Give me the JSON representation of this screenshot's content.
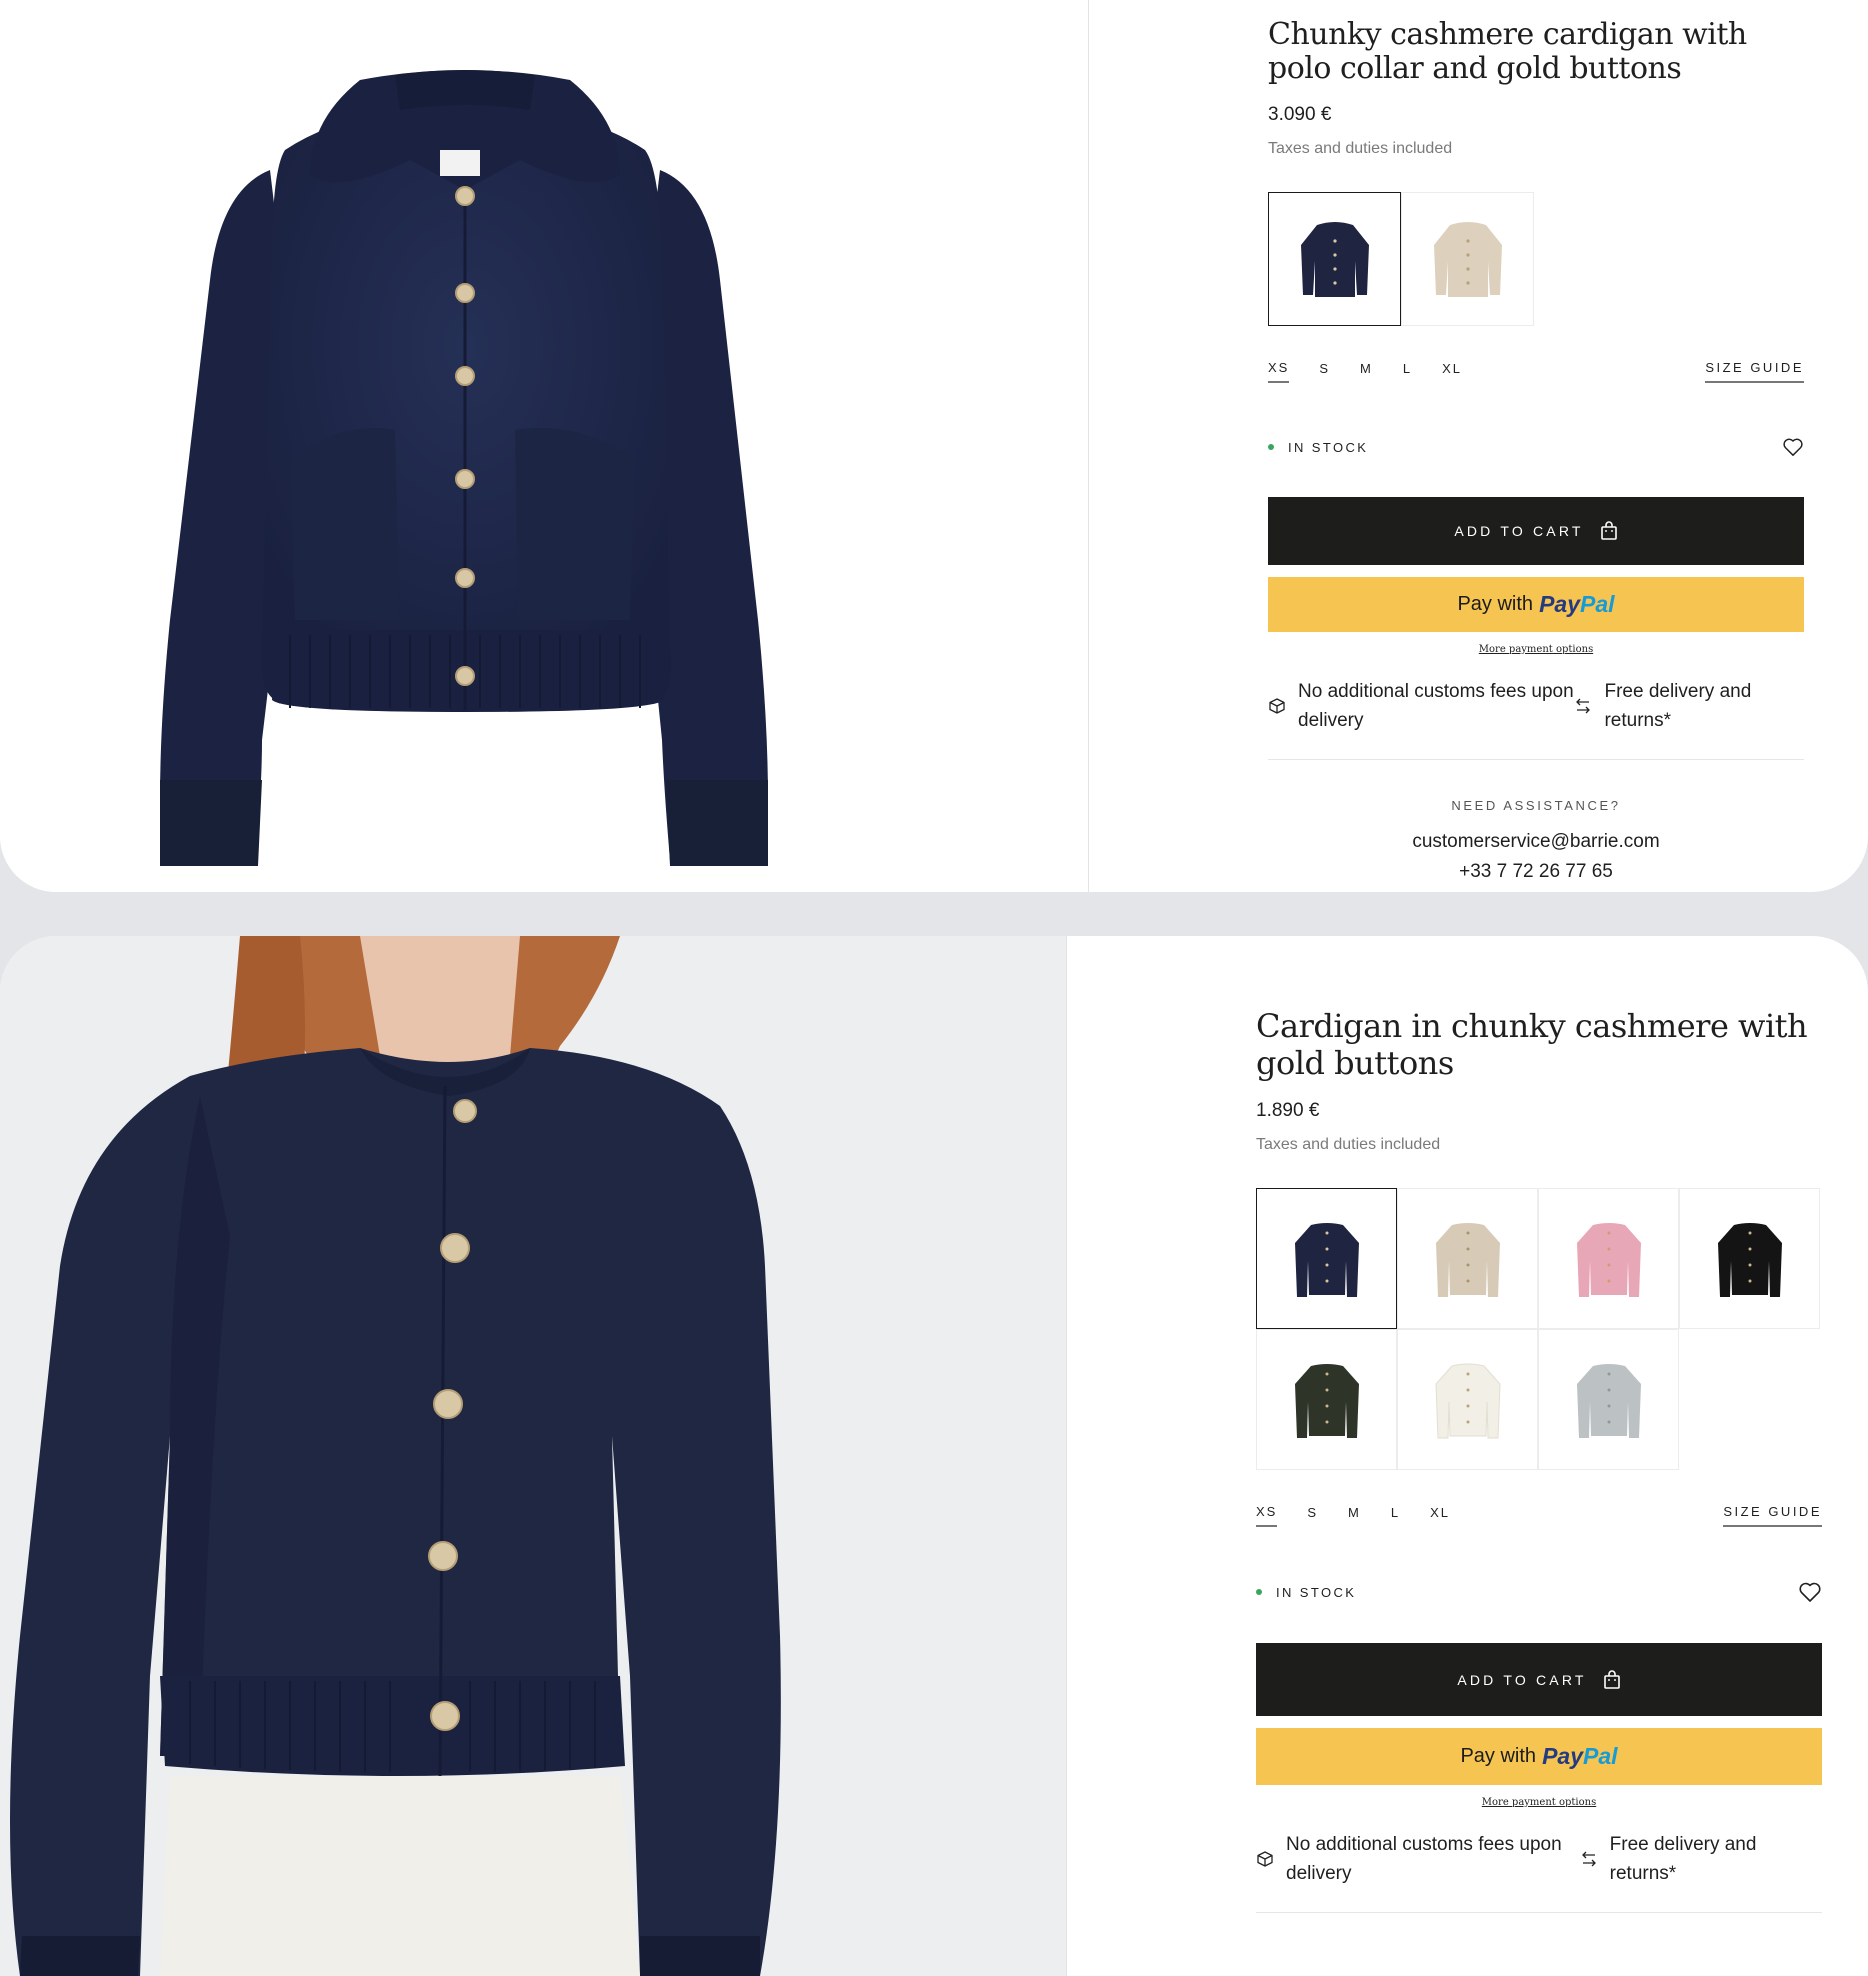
{
  "products": [
    {
      "title": "Chunky cashmere cardigan with polo collar and gold buttons",
      "price": "3.090 €",
      "taxes": "Taxes and duties included",
      "sizes": [
        "XS",
        "S",
        "M",
        "L",
        "XL"
      ],
      "selected_size": "XS",
      "size_guide": "SIZE GUIDE",
      "stock": "IN STOCK",
      "add_to_cart": "ADD TO CART",
      "paypal_prefix": "Pay with",
      "paypal_pay": "Pay",
      "paypal_pal": "Pal",
      "more_payment": "More payment options",
      "feature1": "No additional customs fees upon delivery",
      "feature2": "Free delivery and returns*",
      "assistance": "NEED ASSISTANCE?",
      "email": "customerservice@barrie.com",
      "phone": "+33 7 72 26 77 65",
      "swatches": [
        "#1f2540",
        "#ddd0bd"
      ]
    },
    {
      "title": "Cardigan in chunky cashmere with gold buttons",
      "price": "1.890 €",
      "taxes": "Taxes and duties included",
      "sizes": [
        "XS",
        "S",
        "M",
        "L",
        "XL"
      ],
      "selected_size": "XS",
      "size_guide": "SIZE GUIDE",
      "stock": "IN STOCK",
      "add_to_cart": "ADD TO CART",
      "paypal_prefix": "Pay with",
      "paypal_pay": "Pay",
      "paypal_pal": "Pal",
      "more_payment": "More payment options",
      "feature1": "No additional customs fees upon delivery",
      "feature2": "Free delivery and returns*",
      "swatches": [
        "#1f2540",
        "#d7cbb8",
        "#e8a7b6",
        "#141414",
        "#2f3429",
        "#f2efe6",
        "#bcc2c4"
      ]
    }
  ],
  "colors": {
    "brand_dark": "#1d1d1b",
    "paypal_yellow": "#f6c451",
    "stock_green": "#3aa55f",
    "navy": "#1f2540"
  }
}
